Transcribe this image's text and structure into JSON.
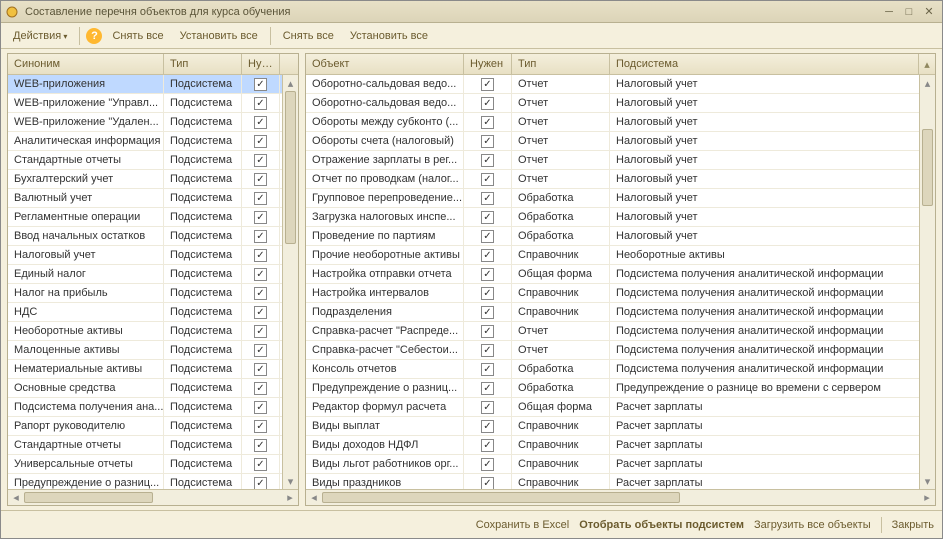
{
  "window": {
    "title": "Составление перечня объектов для курса обучения"
  },
  "toolbar": {
    "actions": "Действия",
    "help": "?",
    "clear_all_left": "Снять все",
    "set_all_left": "Установить все",
    "clear_all_right": "Снять все",
    "set_all_right": "Установить все"
  },
  "left": {
    "headers": {
      "c1": "Синоним",
      "c2": "Тип",
      "c3": "Нуже..."
    },
    "rows": [
      {
        "name": "WEB-приложения",
        "type": "Подсистема",
        "checked": true,
        "selected": true
      },
      {
        "name": "WEB-приложение \"Управл...",
        "type": "Подсистема",
        "checked": true
      },
      {
        "name": "WEB-приложение \"Удален...",
        "type": "Подсистема",
        "checked": true
      },
      {
        "name": "Аналитическая информация",
        "type": "Подсистема",
        "checked": true
      },
      {
        "name": "Стандартные отчеты",
        "type": "Подсистема",
        "checked": true
      },
      {
        "name": "Бухгалтерский учет",
        "type": "Подсистема",
        "checked": true
      },
      {
        "name": "Валютный учет",
        "type": "Подсистема",
        "checked": true
      },
      {
        "name": "Регламентные операции",
        "type": "Подсистема",
        "checked": true
      },
      {
        "name": "Ввод начальных остатков",
        "type": "Подсистема",
        "checked": true
      },
      {
        "name": "Налоговый учет",
        "type": "Подсистема",
        "checked": true
      },
      {
        "name": "Единый налог",
        "type": "Подсистема",
        "checked": true
      },
      {
        "name": "Налог на прибыль",
        "type": "Подсистема",
        "checked": true
      },
      {
        "name": "НДС",
        "type": "Подсистема",
        "checked": true
      },
      {
        "name": "Необоротные активы",
        "type": "Подсистема",
        "checked": true
      },
      {
        "name": "Малоценные активы",
        "type": "Подсистема",
        "checked": true
      },
      {
        "name": "Нематериальные активы",
        "type": "Подсистема",
        "checked": true
      },
      {
        "name": "Основные средства",
        "type": "Подсистема",
        "checked": true
      },
      {
        "name": "Подсистема получения ана...",
        "type": "Подсистема",
        "checked": true
      },
      {
        "name": "Рапорт руководителю",
        "type": "Подсистема",
        "checked": true
      },
      {
        "name": "Стандартные отчеты",
        "type": "Подсистема",
        "checked": true
      },
      {
        "name": "Универсальные отчеты",
        "type": "Подсистема",
        "checked": true
      },
      {
        "name": "Предупреждение о разниц...",
        "type": "Подсистема",
        "checked": true
      }
    ]
  },
  "right": {
    "headers": {
      "c1": "Объект",
      "c2": "Нужен",
      "c3": "Тип",
      "c4": "Подсистема"
    },
    "rows": [
      {
        "obj": "Оборотно-сальдовая ведо...",
        "checked": true,
        "type": "Отчет",
        "sub": "Налоговый учет"
      },
      {
        "obj": "Оборотно-сальдовая ведо...",
        "checked": true,
        "type": "Отчет",
        "sub": "Налоговый учет"
      },
      {
        "obj": "Обороты между субконто (...",
        "checked": true,
        "type": "Отчет",
        "sub": "Налоговый учет"
      },
      {
        "obj": "Обороты счета (налоговый)",
        "checked": true,
        "type": "Отчет",
        "sub": "Налоговый учет"
      },
      {
        "obj": "Отражение зарплаты в рег...",
        "checked": true,
        "type": "Отчет",
        "sub": "Налоговый учет"
      },
      {
        "obj": "Отчет по проводкам (налог...",
        "checked": true,
        "type": "Отчет",
        "sub": "Налоговый учет"
      },
      {
        "obj": "Групповое перепроведение...",
        "checked": true,
        "type": "Обработка",
        "sub": "Налоговый учет"
      },
      {
        "obj": "Загрузка налоговых инспе...",
        "checked": true,
        "type": "Обработка",
        "sub": "Налоговый учет"
      },
      {
        "obj": "Проведение по партиям",
        "checked": true,
        "type": "Обработка",
        "sub": "Налоговый учет"
      },
      {
        "obj": "Прочие необоротные активы",
        "checked": true,
        "type": "Справочник",
        "sub": "Необоротные активы"
      },
      {
        "obj": "Настройка отправки отчета",
        "checked": true,
        "type": "Общая форма",
        "sub": "Подсистема получения аналитической информации"
      },
      {
        "obj": "Настройка интервалов",
        "checked": true,
        "type": "Справочник",
        "sub": "Подсистема получения аналитической информации"
      },
      {
        "obj": "Подразделения",
        "checked": true,
        "type": "Справочник",
        "sub": "Подсистема получения аналитической информации"
      },
      {
        "obj": "Справка-расчет \"Распреде...",
        "checked": true,
        "type": "Отчет",
        "sub": "Подсистема получения аналитической информации"
      },
      {
        "obj": "Справка-расчет \"Себестои...",
        "checked": true,
        "type": "Отчет",
        "sub": "Подсистема получения аналитической информации"
      },
      {
        "obj": "Консоль отчетов",
        "checked": true,
        "type": "Обработка",
        "sub": "Подсистема получения аналитической информации"
      },
      {
        "obj": "Предупреждение о разниц...",
        "checked": true,
        "type": "Обработка",
        "sub": "Предупреждение о разнице во времени с сервером"
      },
      {
        "obj": "Редактор формул расчета",
        "checked": true,
        "type": "Общая форма",
        "sub": "Расчет зарплаты"
      },
      {
        "obj": "Виды выплат",
        "checked": true,
        "type": "Справочник",
        "sub": "Расчет зарплаты"
      },
      {
        "obj": "Виды доходов НДФЛ",
        "checked": true,
        "type": "Справочник",
        "sub": "Расчет зарплаты"
      },
      {
        "obj": "Виды льгот работников орг...",
        "checked": true,
        "type": "Справочник",
        "sub": "Расчет зарплаты"
      },
      {
        "obj": "Виды праздников",
        "checked": true,
        "type": "Справочник",
        "sub": "Расчет зарплаты"
      }
    ]
  },
  "footer": {
    "save_excel": "Сохранить в Excel",
    "select_subsystems": "Отобрать объекты подсистем",
    "load_all": "Загрузить все объекты",
    "close": "Закрыть"
  }
}
